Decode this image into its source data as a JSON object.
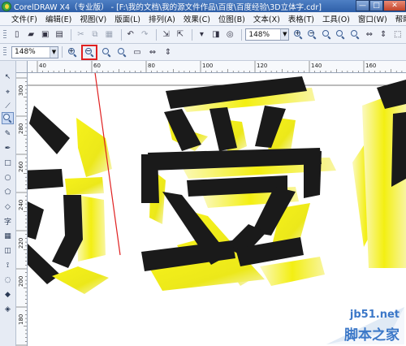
{
  "window": {
    "title": "CorelDRAW X4（专业版） - [F:\\我的文档\\我的源文件作品\\百度\\百度经验\\3D立体字.cdr]",
    "minimize": "—",
    "maximize": "□",
    "close": "✕"
  },
  "menu": [
    "文件(F)",
    "编辑(E)",
    "视图(V)",
    "版面(L)",
    "排列(A)",
    "效果(C)",
    "位图(B)",
    "文本(X)",
    "表格(T)",
    "工具(O)",
    "窗口(W)",
    "帮助(H)"
  ],
  "standard_toolbar": {
    "zoom_value": "148%"
  },
  "property_bar": {
    "zoom_value": "148%"
  },
  "rulers": {
    "top_labels": [
      "40",
      "60",
      "80",
      "100",
      "120",
      "140",
      "160"
    ],
    "left_labels": [
      "300",
      "280",
      "260",
      "240",
      "220",
      "200",
      "180",
      "160"
    ]
  },
  "canvas": {
    "text_art": [
      "我",
      "爱",
      "你"
    ],
    "fill_color": "#1a1a1a",
    "extrude_color": "#f2ee12"
  },
  "watermark": {
    "url": "jb51.net",
    "site": "脚本之家"
  },
  "colors": {
    "titlebar": "#3a69b2",
    "annotation_red": "#e02020"
  }
}
